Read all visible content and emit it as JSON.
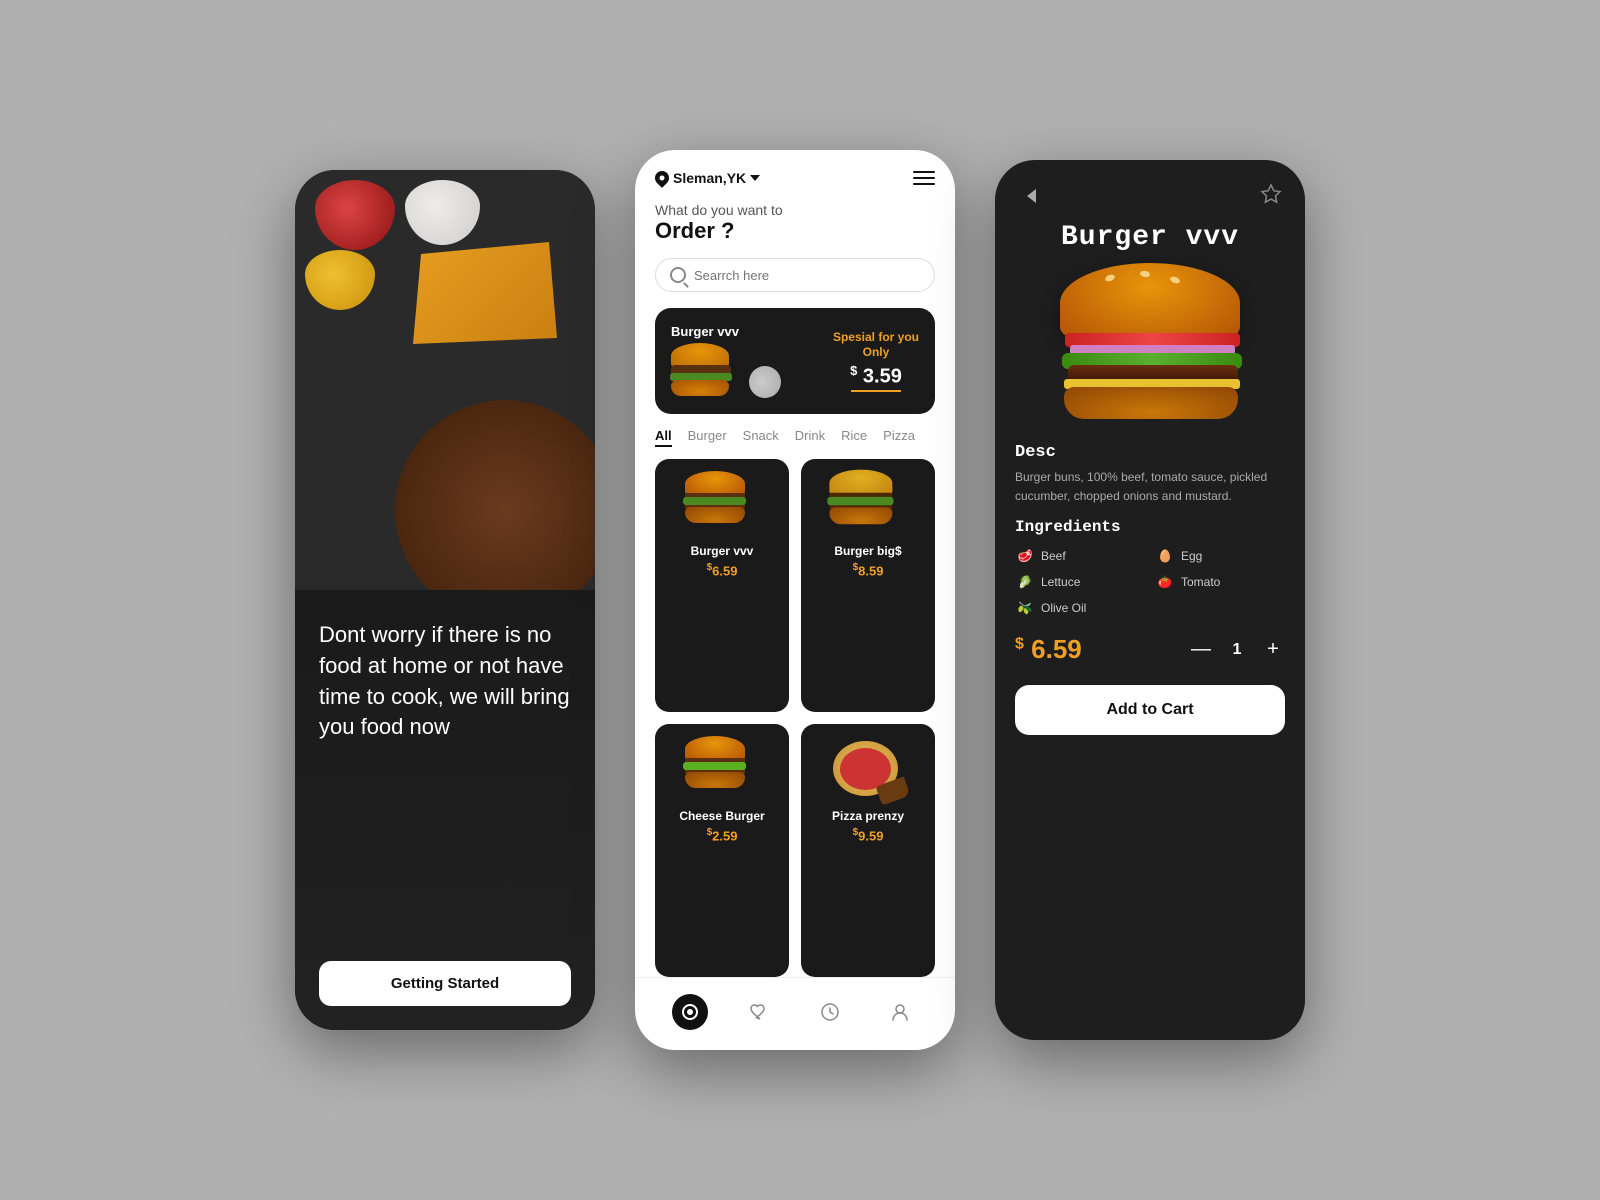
{
  "background": "#b0b0b0",
  "phone1": {
    "tagline": "Dont worry if there is no food at home or not have time to cook, we will bring you food now",
    "cta_button": "Getting Started"
  },
  "phone2": {
    "location": "Sleman,YK",
    "greeting_sub": "What do you want to",
    "greeting_main": "Order ?",
    "search_placeholder": "Searrch here",
    "promo": {
      "name": "Burger vvv",
      "special_label": "Spesial for you\nOnly",
      "price": "3.59",
      "dollar_sign": "$"
    },
    "categories": [
      "All",
      "Burger",
      "Snack",
      "Drink",
      "Rice",
      "Pizza"
    ],
    "active_category": "All",
    "food_items": [
      {
        "name": "Burger vvv",
        "price": "6.59"
      },
      {
        "name": "Burger big$",
        "price": "8.59"
      },
      {
        "name": "Cheese Burger",
        "price": "2.59"
      },
      {
        "name": "Pizza prenzy",
        "price": "9.59"
      }
    ]
  },
  "phone3": {
    "title": "Burger vvv",
    "desc_title": "Desc",
    "description": "Burger buns, 100% beef, tomato sauce, pickled cucumber, chopped onions and mustard.",
    "ingredients_title": "Ingredients",
    "ingredients": [
      {
        "name": "Beef",
        "icon": "🥩",
        "col": 1
      },
      {
        "name": "Egg",
        "icon": "🥚",
        "col": 2
      },
      {
        "name": "Lettuce",
        "icon": "🥬",
        "col": 1
      },
      {
        "name": "Tomato",
        "icon": "🍅",
        "col": 2
      },
      {
        "name": "Olive Oil",
        "icon": "🫒",
        "col": 1
      }
    ],
    "price": "6.59",
    "dollar_sign": "$",
    "quantity": "1",
    "add_to_cart_label": "Add to Cart",
    "back_label": "<",
    "favorite_label": "★"
  }
}
